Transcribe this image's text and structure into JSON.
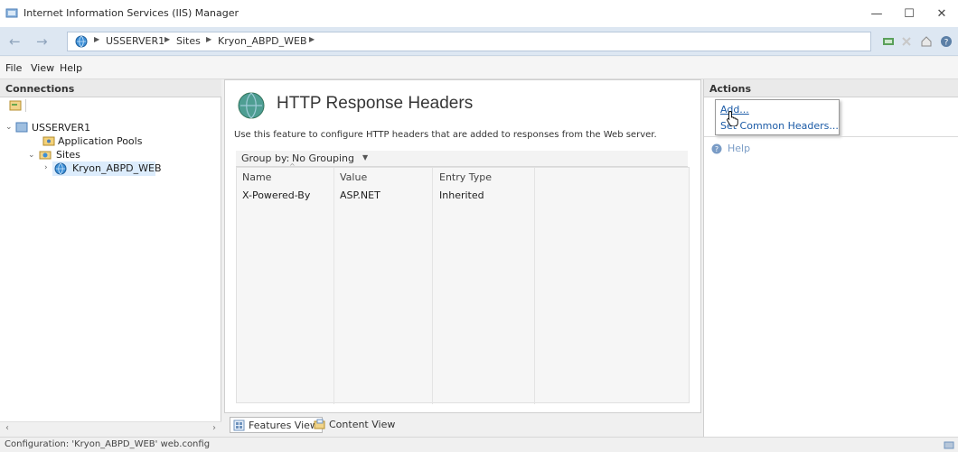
{
  "window": {
    "title": "Internet Information Services (IIS) Manager",
    "minimize": "—",
    "maximize": "☐",
    "close": "✕"
  },
  "address": {
    "crumbs": [
      "USSERVER1",
      "Sites",
      "Kryon_ABPD_WEB"
    ]
  },
  "menu": {
    "file": "File",
    "view": "View",
    "help": "Help"
  },
  "connections": {
    "header": "Connections",
    "tree": {
      "server": "USSERVER1",
      "app_pools": "Application Pools",
      "sites": "Sites",
      "site": "Kryon_ABPD_WEB"
    }
  },
  "feature": {
    "title": "HTTP Response Headers",
    "description": "Use this feature to configure HTTP headers that are added to responses from the Web server.",
    "group_label": "Group by:",
    "group_value": "No Grouping",
    "columns": [
      "Name",
      "Value",
      "Entry Type"
    ],
    "rows": [
      [
        "X-Powered-By",
        "ASP.NET",
        "Inherited"
      ]
    ],
    "tabs": {
      "features": "Features View",
      "content": "Content View"
    }
  },
  "actions": {
    "header": "Actions",
    "add": "Add...",
    "set_common": "Set Common Headers...",
    "help": "Help"
  },
  "status": {
    "text": "Configuration: 'Kryon_ABPD_WEB' web.config"
  },
  "colors": {
    "link": "#1a5aa6",
    "selected": "#dcecfc",
    "addressbar": "#dde7f2"
  }
}
